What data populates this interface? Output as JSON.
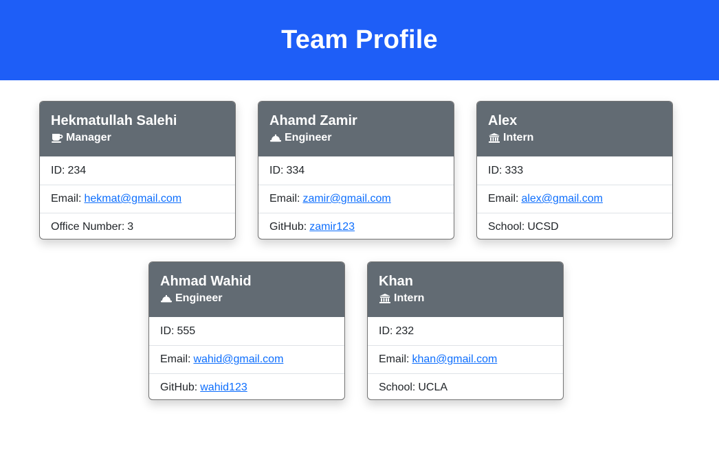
{
  "header": {
    "title": "Team Profile"
  },
  "employees": [
    {
      "name": "Hekmatullah Salehi",
      "role": "Manager",
      "role_icon": "mug-icon",
      "id_label": "ID:",
      "id": "234",
      "email_label": "Email:",
      "email": "hekmat@gmail.com",
      "extra_label": "Office Number:",
      "extra": "3"
    },
    {
      "name": "Ahamd Zamir",
      "role": "Engineer",
      "role_icon": "hard-hat-icon",
      "id_label": "ID:",
      "id": "334",
      "email_label": "Email:",
      "email": "zamir@gmail.com",
      "extra_label": "GitHub:",
      "extra": "zamir123"
    },
    {
      "name": "Alex",
      "role": "Intern",
      "role_icon": "school-building-icon",
      "id_label": "ID:",
      "id": "333",
      "email_label": "Email:",
      "email": "alex@gmail.com",
      "extra_label": "School:",
      "extra": "UCSD"
    },
    {
      "name": "Ahmad Wahid",
      "role": "Engineer",
      "role_icon": "hard-hat-icon",
      "id_label": "ID:",
      "id": "555",
      "email_label": "Email:",
      "email": "wahid@gmail.com",
      "extra_label": "GitHub:",
      "extra": "wahid123"
    },
    {
      "name": "Khan",
      "role": "Intern",
      "role_icon": "school-building-icon",
      "id_label": "ID:",
      "id": "232",
      "email_label": "Email:",
      "email": "khan@gmail.com",
      "extra_label": "School:",
      "extra": "UCLA"
    }
  ],
  "colors": {
    "header_bg": "#1e5ef7",
    "card_header_bg": "#626b73",
    "link": "#0d6efd"
  }
}
